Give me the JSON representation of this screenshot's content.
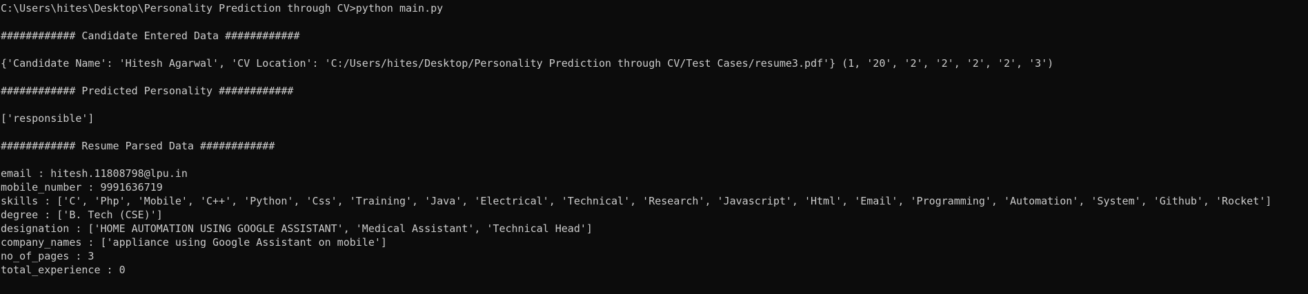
{
  "terminal": {
    "prompt_command": "C:\\Users\\hites\\Desktop\\Personality Prediction through CV>python main.py",
    "header_candidate": "############ Candidate Entered Data ############",
    "candidate_data": "{'Candidate Name': 'Hitesh Agarwal', 'CV Location': 'C:/Users/hites/Desktop/Personality Prediction through CV/Test Cases/resume3.pdf'} (1, '20', '2', '2', '2', '2', '3')",
    "header_predicted": "############ Predicted Personality ############",
    "predicted_personality": "['responsible']",
    "header_resume": "############ Resume Parsed Data ############",
    "fields": {
      "email": "email : hitesh.11808798@lpu.in",
      "mobile_number": "mobile_number : 9991636719",
      "skills": "skills : ['C', 'Php', 'Mobile', 'C++', 'Python', 'Css', 'Training', 'Java', 'Electrical', 'Technical', 'Research', 'Javascript', 'Html', 'Email', 'Programming', 'Automation', 'System', 'Github', 'Rocket']",
      "degree": "degree : ['B. Tech (CSE)']",
      "designation": "designation : ['HOME AUTOMATION USING GOOGLE ASSISTANT', 'Medical Assistant', 'Technical Head']",
      "company_names": "company_names : ['appliance using Google Assistant on mobile']",
      "no_of_pages": "no_of_pages : 3",
      "total_experience": "total_experience : 0"
    }
  }
}
